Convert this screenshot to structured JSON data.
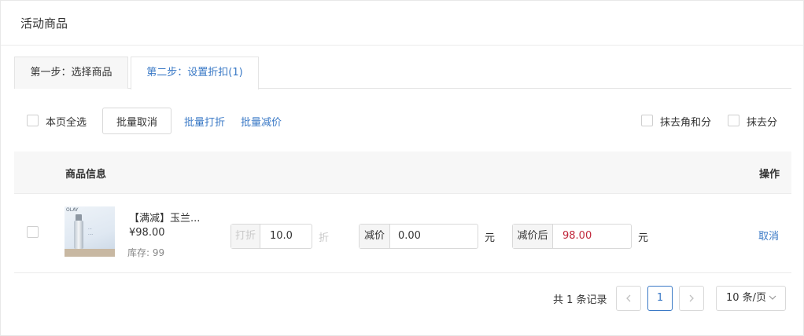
{
  "panel": {
    "title": "活动商品"
  },
  "tabs": [
    {
      "label": "第一步：选择商品",
      "active": false
    },
    {
      "label": "第二步：设置折扣(1)",
      "active": true
    }
  ],
  "toolbar": {
    "select_all_label": "本页全选",
    "batch_cancel_label": "批量取消",
    "batch_discount_label": "批量打折",
    "batch_reduce_label": "批量减价",
    "round_jiao_label": "抹去角和分",
    "round_fen_label": "抹去分"
  },
  "table": {
    "headers": {
      "product_info": "商品信息",
      "operation": "操作"
    },
    "rows": [
      {
        "thumb_brand": "OLAY",
        "name": "【满减】玉兰...",
        "price": "¥98.00",
        "stock": "库存: 99",
        "discount_addon": "打折",
        "discount_value": "10.0",
        "discount_unit": "折",
        "reduce_addon": "减价",
        "reduce_value": "0.00",
        "reduce_unit": "元",
        "after_addon": "减价后",
        "after_value": "98.00",
        "after_unit": "元",
        "cancel_label": "取消"
      }
    ]
  },
  "pagination": {
    "total_text": "共 1 条记录",
    "prev_icon": "chevron-left-icon",
    "current_page": "1",
    "next_icon": "chevron-right-icon",
    "page_size": "10 条/页"
  },
  "colors": {
    "link": "#3a79c6",
    "after_price": "#c0263a",
    "disabled_text": "#c8c8c8"
  }
}
